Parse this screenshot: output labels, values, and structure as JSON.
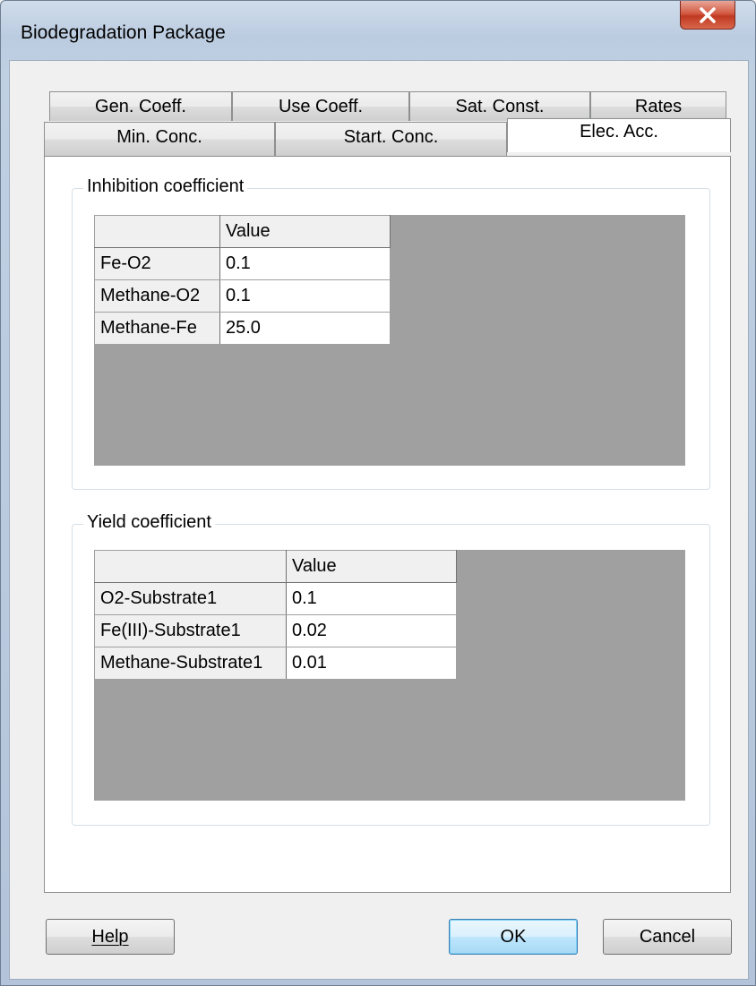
{
  "window": {
    "title": "Biodegradation Package",
    "close_label": "X"
  },
  "tabs_back": [
    "Gen. Coeff.",
    "Use Coeff.",
    "Sat. Const.",
    "Rates"
  ],
  "tabs_front": [
    "Min. Conc.",
    "Start. Conc.",
    "Elec. Acc."
  ],
  "active_tab": "Elec. Acc.",
  "inhibition": {
    "group_label": "Inhibition coefficient",
    "column_header": "Value",
    "rows": [
      {
        "name": "Fe-O2",
        "value": "0.1"
      },
      {
        "name": "Methane-O2",
        "value": "0.1"
      },
      {
        "name": "Methane-Fe",
        "value": "25.0"
      }
    ]
  },
  "yield": {
    "group_label": "Yield coefficient",
    "column_header": "Value",
    "rows": [
      {
        "name": "O2-Substrate1",
        "value": "0.1"
      },
      {
        "name": "Fe(III)-Substrate1",
        "value": "0.02"
      },
      {
        "name": "Methane-Substrate1",
        "value": "0.01"
      }
    ]
  },
  "buttons": {
    "help": "Help",
    "ok": "OK",
    "cancel": "Cancel"
  },
  "colors": {
    "grid_background": "#a0a0a0",
    "close_button": "#c8452d",
    "default_button": "#3c7fb1"
  }
}
